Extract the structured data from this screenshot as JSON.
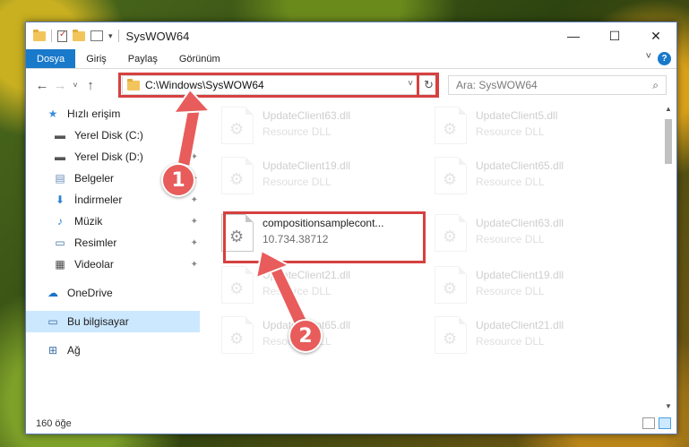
{
  "window": {
    "title": "SysWOW64",
    "controls": {
      "minimize": "—",
      "maximize": "☐",
      "close": "✕"
    }
  },
  "ribbon": {
    "tabs": [
      "Dosya",
      "Giriş",
      "Paylaş",
      "Görünüm"
    ],
    "active_tab": "Dosya",
    "help": "?",
    "collapse": "˅"
  },
  "navigation": {
    "back": "←",
    "forward": "→",
    "recent": "˅",
    "up": "↑",
    "address": "C:\\Windows\\SysWOW64",
    "address_dropdown": "˅",
    "refresh": "↻",
    "search_placeholder": "Ara: SysWOW64",
    "search_icon": "⌕"
  },
  "sidebar": {
    "items": [
      {
        "label": "Hızlı erişim",
        "icon": "star-icon",
        "glyph": "★",
        "pinned": false
      },
      {
        "label": "Yerel Disk (C:)",
        "icon": "drive-icon",
        "glyph": "▬",
        "pinned": true
      },
      {
        "label": "Yerel Disk (D:)",
        "icon": "drive-icon",
        "glyph": "▬",
        "pinned": true
      },
      {
        "label": "Belgeler",
        "icon": "documents-icon",
        "glyph": "▤",
        "pinned": true
      },
      {
        "label": "İndirmeler",
        "icon": "download-icon",
        "glyph": "⬇",
        "pinned": true
      },
      {
        "label": "Müzik",
        "icon": "music-icon",
        "glyph": "♪",
        "pinned": true
      },
      {
        "label": "Resimler",
        "icon": "pictures-icon",
        "glyph": "▭",
        "pinned": true
      },
      {
        "label": "Videolar",
        "icon": "videos-icon",
        "glyph": "▦",
        "pinned": true
      },
      {
        "label": "OneDrive",
        "icon": "cloud-icon",
        "glyph": "☁",
        "pinned": false
      },
      {
        "label": "Bu bilgisayar",
        "icon": "computer-icon",
        "glyph": "▭",
        "pinned": false,
        "selected": true
      },
      {
        "label": "Ağ",
        "icon": "network-icon",
        "glyph": "⊞",
        "pinned": false
      }
    ],
    "pin_glyph": "📌"
  },
  "files": [
    {
      "name": "UpdateClient63.dll",
      "sub": "Resource DLL",
      "faded": true
    },
    {
      "name": "UpdateClient5.dll",
      "sub": "Resource DLL",
      "faded": true
    },
    {
      "name": "UpdateClient19.dll",
      "sub": "Resource DLL",
      "faded": true
    },
    {
      "name": "UpdateClient65.dll",
      "sub": "Resource DLL",
      "faded": true
    },
    {
      "name": "compositionsamplecont...",
      "sub": "10.734.38712",
      "faded": false
    },
    {
      "name": "UpdateClient63.dll",
      "sub": "Resource DLL",
      "faded": true
    },
    {
      "name": "UpdateClient21.dll",
      "sub": "Resource DLL",
      "faded": true
    },
    {
      "name": "UpdateClient19.dll",
      "sub": "Resource DLL",
      "faded": true
    },
    {
      "name": "UpdateClient65.dll",
      "sub": "Resource DLL",
      "faded": true
    },
    {
      "name": "UpdateClient21.dll",
      "sub": "Resource DLL",
      "faded": true
    }
  ],
  "status": {
    "count": "160 öğe"
  },
  "annotations": {
    "badge1": "1",
    "badge2": "2",
    "color": "#e85c5c"
  }
}
